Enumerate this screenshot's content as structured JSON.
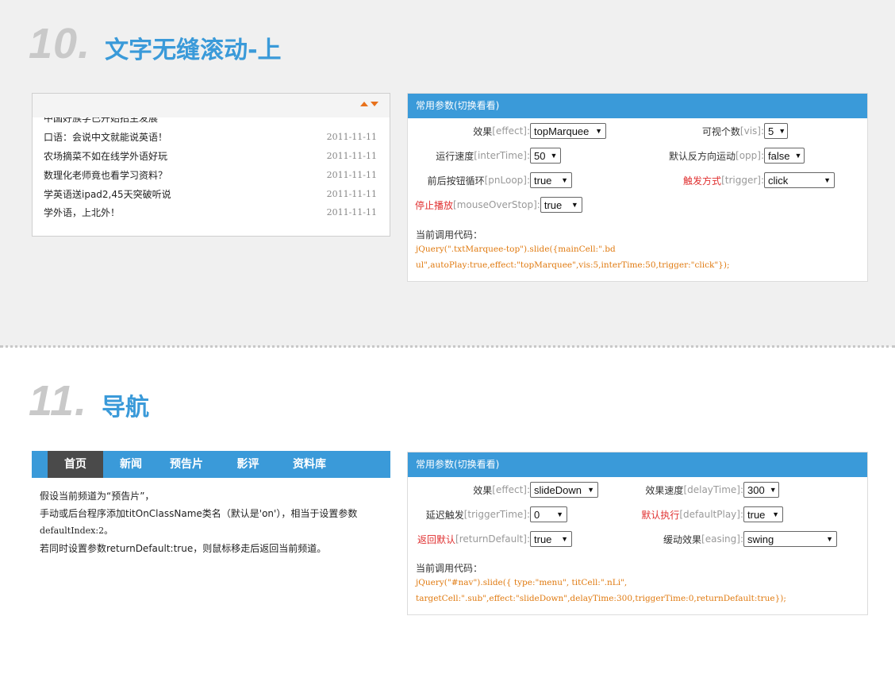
{
  "sec10": {
    "num": "10.",
    "title": "文字无缝滚动-上",
    "marquee": {
      "partial_item": "中国好族学已开始招生发展",
      "items": [
        {
          "title": "口语：会说中文就能说英语！",
          "date": "2011-11-11"
        },
        {
          "title": "农场摘菜不如在线学外语好玩",
          "date": "2011-11-11"
        },
        {
          "title": "数理化老师竟也看学习资料？",
          "date": "2011-11-11"
        },
        {
          "title": "学英语送ipad2,45天突破听说",
          "date": "2011-11-11"
        },
        {
          "title": "学外语，上北外！",
          "date": "2011-11-11"
        }
      ]
    },
    "panel": {
      "header": "常用参数(切换看看)",
      "params": [
        {
          "cn": "效果",
          "en": "[effect]:",
          "value": "topMarquee",
          "red": false
        },
        {
          "cn": "可视个数",
          "en": "[vis]:",
          "value": "5",
          "red": false
        },
        {
          "cn": "运行速度",
          "en": "[interTime]:",
          "value": "50",
          "red": false
        },
        {
          "cn": "默认反方向运动",
          "en": "[opp]:",
          "value": "false",
          "red": false
        },
        {
          "cn": "前后按钮循环",
          "en": "[pnLoop]:",
          "value": "true",
          "red": false
        },
        {
          "cn": "触发方式",
          "en": "[trigger]:",
          "value": "click",
          "red": true
        },
        {
          "cn": "停止播放",
          "en": "[mouseOverStop]:",
          "value": "true",
          "red": true
        }
      ],
      "code_label": "当前调用代码：",
      "code_lines": [
        "jQuery(\".txtMarquee-top\").slide({mainCell:\".bd",
        "ul\",autoPlay:true,effect:\"topMarquee\",vis:5,interTime:50,trigger:\"click\"});"
      ]
    }
  },
  "sec11": {
    "num": "11.",
    "title": "导航",
    "nav": [
      "首页",
      "新闻",
      "预告片",
      "影评",
      "资料库"
    ],
    "desc": [
      "假设当前频道为“预告片”，",
      "手动或后台程序添加titOnClassName类名（默认是'on'），相当于设置参数",
      "defaultIndex:2。",
      "若同时设置参数returnDefault:true，则鼠标移走后返回当前频道。"
    ],
    "panel": {
      "header": "常用参数(切换看看)",
      "params": [
        {
          "cn": "效果",
          "en": "[effect]:",
          "value": "slideDown",
          "red": false
        },
        {
          "cn": "效果速度",
          "en": "[delayTime]:",
          "value": "300",
          "red": false
        },
        {
          "cn": "延迟触发",
          "en": "[triggerTime]:",
          "value": "0",
          "red": false
        },
        {
          "cn": "默认执行",
          "en": "[defaultPlay]:",
          "value": "true",
          "red": true
        },
        {
          "cn": "返回默认",
          "en": "[returnDefault]:",
          "value": "true",
          "red": true
        },
        {
          "cn": "缓动效果",
          "en": "[easing]:",
          "value": "swing",
          "red": false
        }
      ],
      "code_label": "当前调用代码：",
      "code_lines": [
        "jQuery(\"#nav\").slide({ type:\"menu\",  titCell:\".nLi\",",
        "targetCell:\".sub\",effect:\"slideDown\",delayTime:300,triggerTime:0,returnDefault:true});"
      ]
    }
  }
}
